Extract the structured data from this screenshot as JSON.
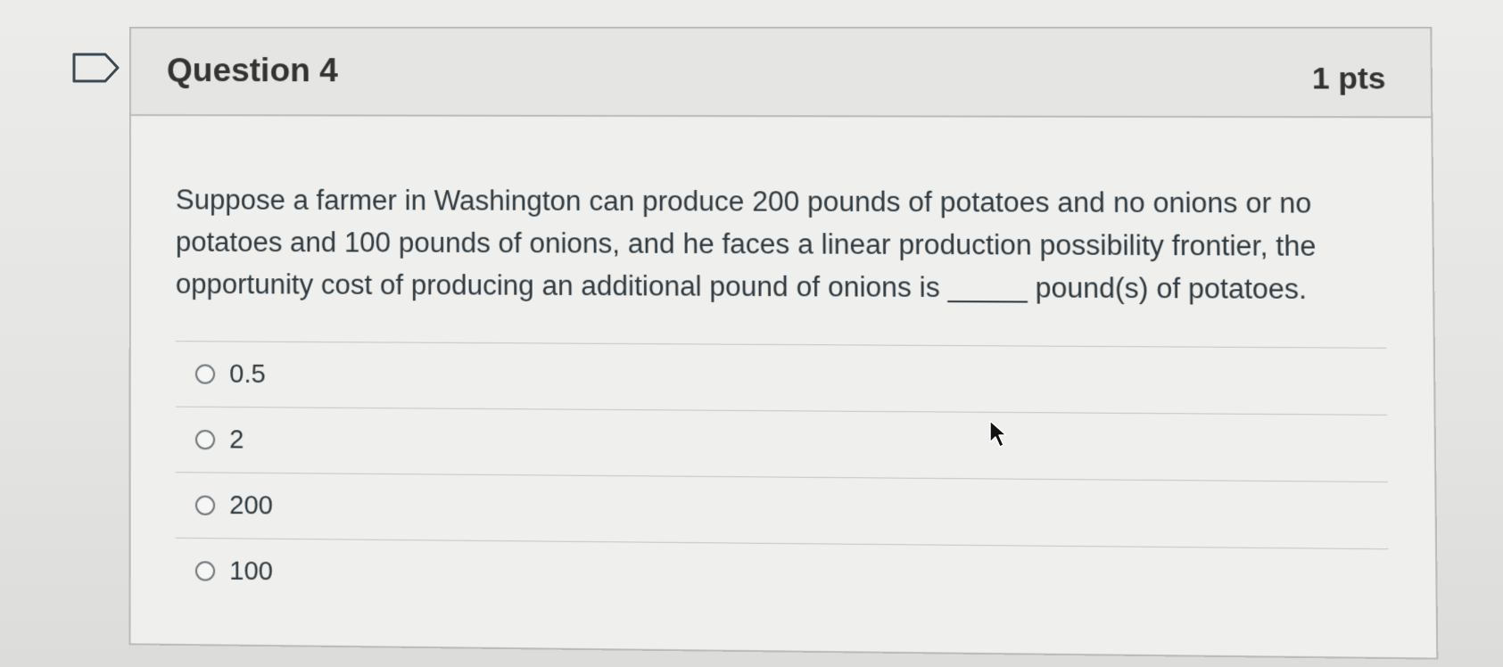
{
  "question": {
    "title": "Question 4",
    "points": "1 pts",
    "text": "Suppose a farmer in Washington can produce 200 pounds of potatoes and no onions or no potatoes and 100 pounds of onions, and he faces a linear production possibility frontier, the opportunity cost of producing an additional pound of onions is _____ pound(s) of potatoes.",
    "answers": [
      {
        "label": "0.5"
      },
      {
        "label": "2"
      },
      {
        "label": "200"
      },
      {
        "label": "100"
      }
    ]
  },
  "icons": {
    "flag": "flag-outline-icon",
    "cursor": "mouse-pointer-icon"
  },
  "colors": {
    "border": "#b9bcbd",
    "text": "#2f3a40",
    "background": "#efefed"
  }
}
